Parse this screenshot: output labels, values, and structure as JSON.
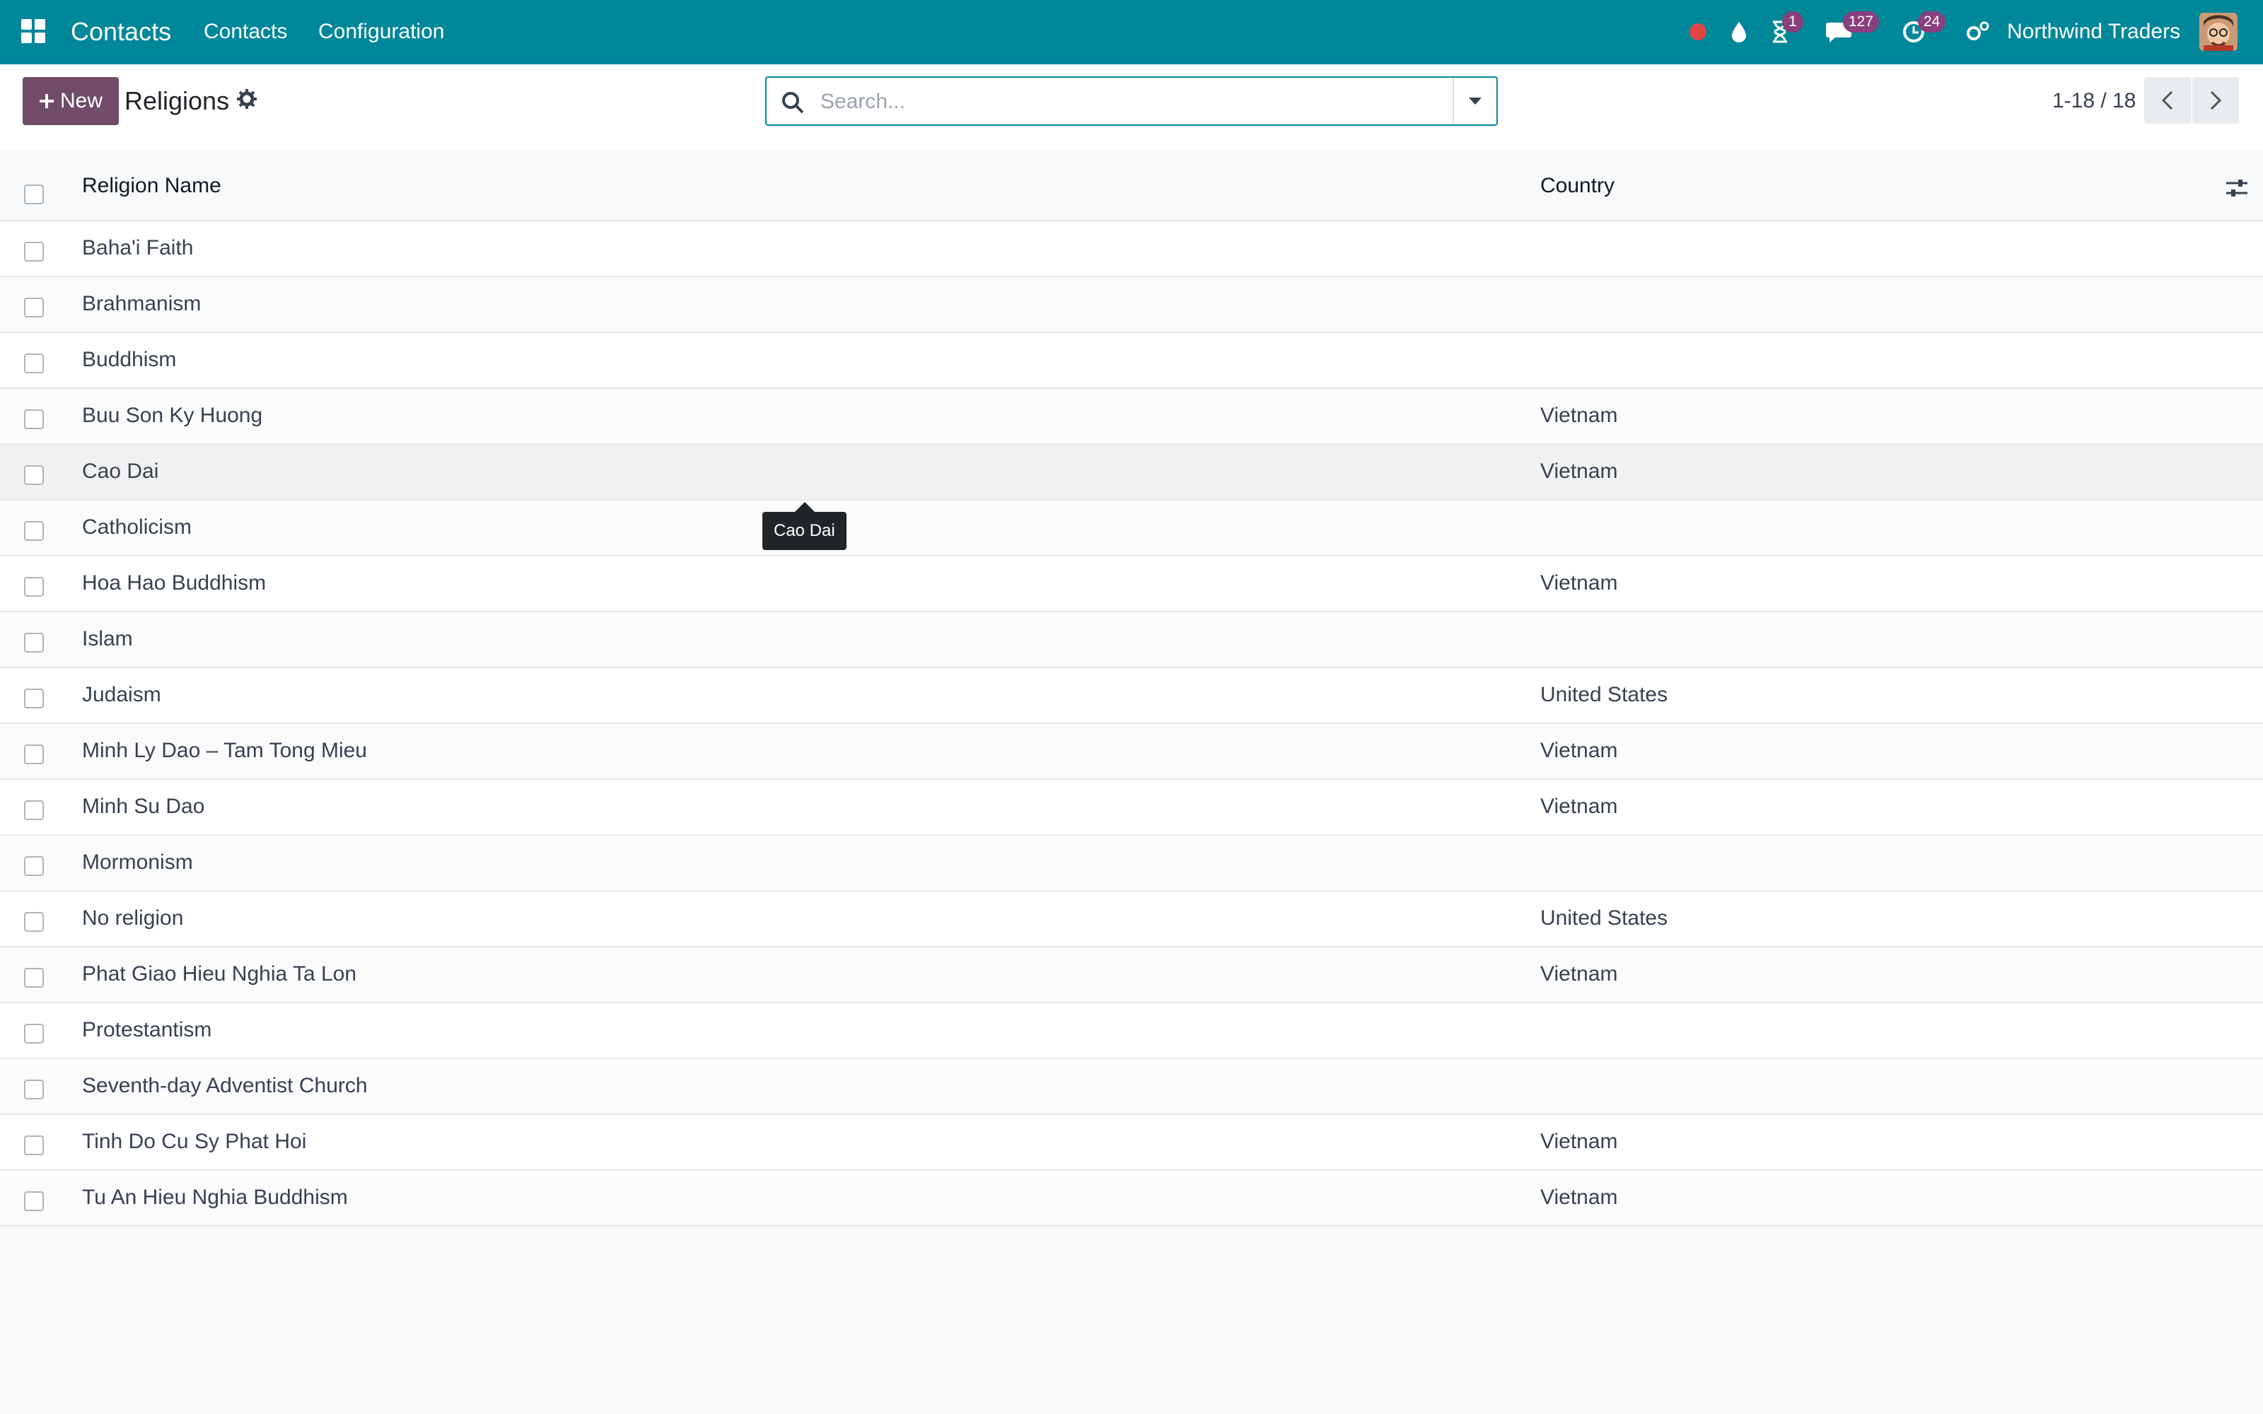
{
  "navbar": {
    "app_title": "Contacts",
    "menus": [
      {
        "label": "Contacts"
      },
      {
        "label": "Configuration"
      }
    ],
    "activity_badge": "1",
    "messages_badge": "127",
    "activity2_badge": "24",
    "company": "Northwind Traders",
    "accent_color": "#00879a",
    "badge_color": "#8a3f7e"
  },
  "control": {
    "new_label": "New",
    "title": "Religions",
    "search_placeholder": "Search...",
    "pager": "1-18 / 18",
    "new_button_color": "#714b67"
  },
  "list": {
    "headers": {
      "name": "Religion Name",
      "country": "Country"
    },
    "rows": [
      {
        "name": "Baha'i Faith",
        "country": ""
      },
      {
        "name": "Brahmanism",
        "country": ""
      },
      {
        "name": "Buddhism",
        "country": ""
      },
      {
        "name": "Buu Son Ky Huong",
        "country": "Vietnam"
      },
      {
        "name": "Cao Dai",
        "country": "Vietnam"
      },
      {
        "name": "Catholicism",
        "country": ""
      },
      {
        "name": "Hoa Hao Buddhism",
        "country": "Vietnam"
      },
      {
        "name": "Islam",
        "country": ""
      },
      {
        "name": "Judaism",
        "country": "United States"
      },
      {
        "name": "Minh Ly Dao – Tam Tong Mieu",
        "country": "Vietnam"
      },
      {
        "name": "Minh Su Dao",
        "country": "Vietnam"
      },
      {
        "name": "Mormonism",
        "country": ""
      },
      {
        "name": "No religion",
        "country": "United States"
      },
      {
        "name": "Phat Giao Hieu Nghia Ta Lon",
        "country": "Vietnam"
      },
      {
        "name": "Protestantism",
        "country": ""
      },
      {
        "name": "Seventh-day Adventist Church",
        "country": ""
      },
      {
        "name": "Tinh Do Cu Sy Phat Hoi",
        "country": "Vietnam"
      },
      {
        "name": "Tu An Hieu Nghia Buddhism",
        "country": "Vietnam"
      }
    ]
  },
  "tooltip": {
    "text": "Cao Dai"
  }
}
